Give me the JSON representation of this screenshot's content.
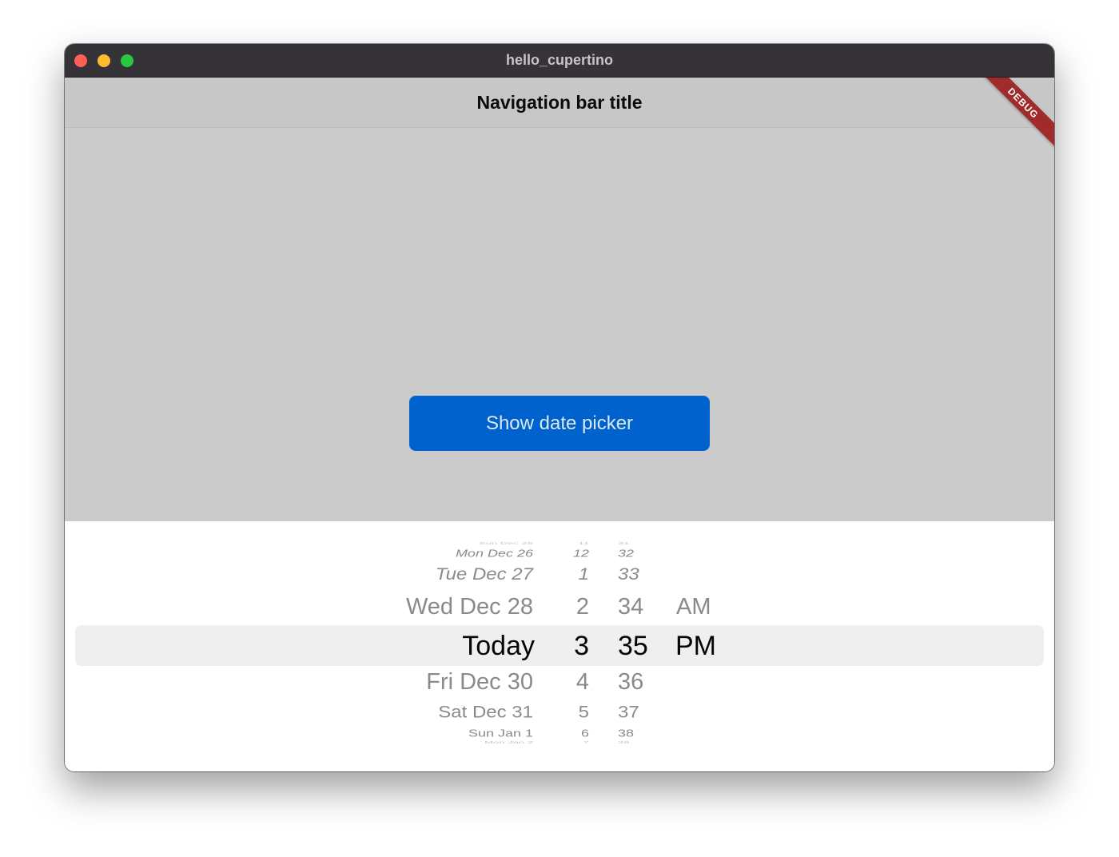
{
  "window": {
    "title": "hello_cupertino"
  },
  "navbar": {
    "title": "Navigation bar title",
    "debug_banner": "DEBUG"
  },
  "main": {
    "show_button_label": "Show date picker"
  },
  "picker": {
    "rows": [
      {
        "date": "Sun Dec 25",
        "hour": "11",
        "minute": "31",
        "ampm": ""
      },
      {
        "date": "Mon Dec 26",
        "hour": "12",
        "minute": "32",
        "ampm": ""
      },
      {
        "date": "Tue Dec 27",
        "hour": "1",
        "minute": "33",
        "ampm": ""
      },
      {
        "date": "Wed Dec 28",
        "hour": "2",
        "minute": "34",
        "ampm": "AM"
      },
      {
        "date": "Today",
        "hour": "3",
        "minute": "35",
        "ampm": "PM"
      },
      {
        "date": "Fri Dec 30",
        "hour": "4",
        "minute": "36",
        "ampm": ""
      },
      {
        "date": "Sat Dec 31",
        "hour": "5",
        "minute": "37",
        "ampm": ""
      },
      {
        "date": "Sun Jan 1",
        "hour": "6",
        "minute": "38",
        "ampm": ""
      },
      {
        "date": "Mon Jan 2",
        "hour": "7",
        "minute": "39",
        "ampm": ""
      }
    ],
    "selected_index": 4
  }
}
